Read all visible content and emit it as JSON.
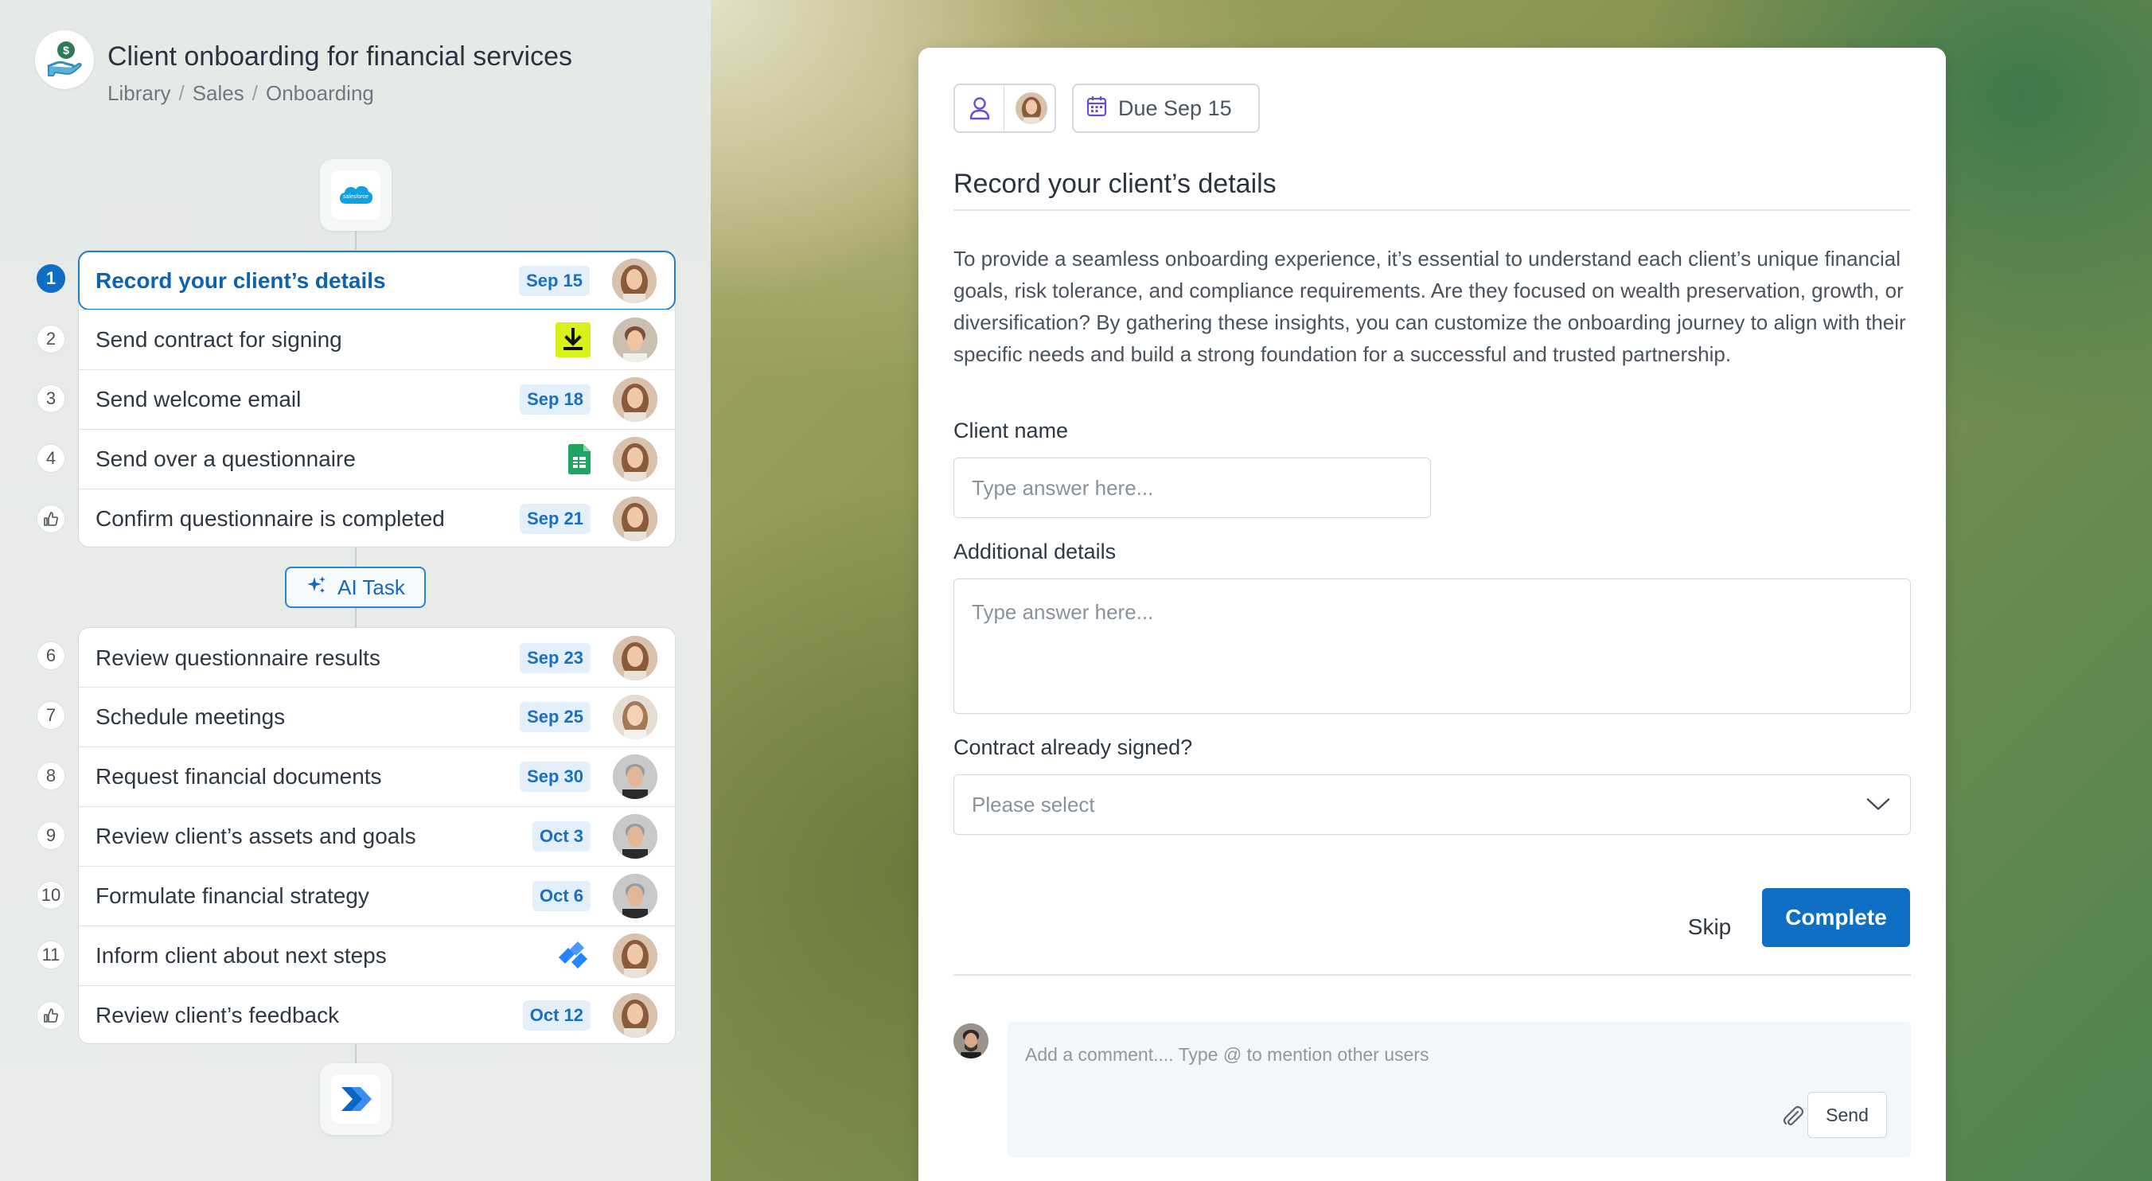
{
  "header": {
    "title": "Client onboarding for financial services",
    "breadcrumbs": [
      "Library",
      "Sales",
      "Onboarding"
    ],
    "logo_icon": "money-hand-icon"
  },
  "workflow": {
    "start_integration": "salesforce-logo",
    "end_integration": "power-automate-logo",
    "ai_task_label": "AI Task",
    "group1": [
      {
        "step": "1",
        "label": "Record your client’s details",
        "badge": "Sep 15",
        "active": true
      },
      {
        "step": "2",
        "label": "Send contract for signing",
        "icon": "download-icon"
      },
      {
        "step": "3",
        "label": "Send welcome email",
        "badge": "Sep 18"
      },
      {
        "step": "4",
        "label": "Send over a questionnaire",
        "icon": "google-sheets-icon"
      },
      {
        "step": "thumbs-up",
        "label": "Confirm questionnaire is completed",
        "badge": "Sep 21"
      }
    ],
    "group2": [
      {
        "step": "6",
        "label": "Review questionnaire results",
        "badge": "Sep 23"
      },
      {
        "step": "7",
        "label": "Schedule meetings",
        "badge": "Sep 25"
      },
      {
        "step": "8",
        "label": "Request financial documents",
        "badge": "Sep 30"
      },
      {
        "step": "9",
        "label": "Review client’s assets and goals",
        "badge": "Oct 3"
      },
      {
        "step": "10",
        "label": "Formulate financial strategy",
        "badge": "Oct 6"
      },
      {
        "step": "11",
        "label": "Inform client about next steps",
        "icon": "jira-icon"
      },
      {
        "step": "thumbs-up",
        "label": "Review client’s feedback",
        "badge": "Oct 12"
      }
    ]
  },
  "task_detail": {
    "due_label": "Due Sep 15",
    "title": "Record your client’s details",
    "description": "To provide a seamless onboarding experience, it’s essential to understand each client’s unique financial goals, risk tolerance, and compliance requirements. Are they focused on wealth preservation, growth, or diversification? By gathering these insights, you can customize the onboarding journey to align with their specific needs and build a strong foundation for a successful and trusted partnership.",
    "fields": {
      "client_name_label": "Client name",
      "client_name_placeholder": "Type answer here...",
      "additional_details_label": "Additional details",
      "additional_details_placeholder": "Type answer here...",
      "contract_label": "Contract already signed?",
      "contract_placeholder": "Please select"
    },
    "actions": {
      "skip": "Skip",
      "complete": "Complete"
    },
    "comment": {
      "placeholder": "Add a comment.... Type @ to mention other users",
      "send": "Send"
    }
  },
  "colors": {
    "accent": "#0f6fc4",
    "badge_bg": "#e3effb",
    "badge_text": "#1b6fc0"
  }
}
